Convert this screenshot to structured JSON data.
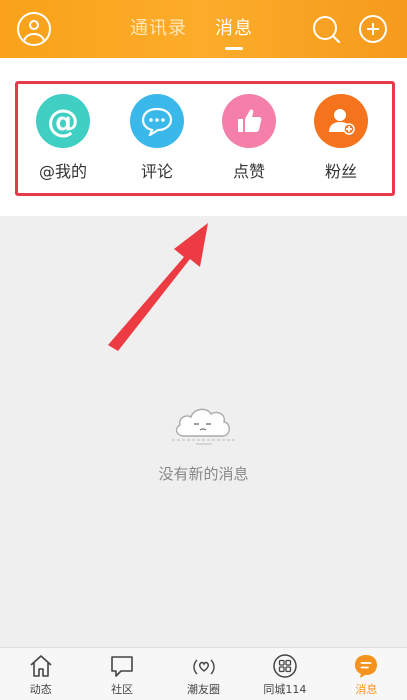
{
  "header": {
    "tabs": [
      {
        "label": "通讯录",
        "active": false
      },
      {
        "label": "消息",
        "active": true
      }
    ]
  },
  "categories": [
    {
      "label": "@我的",
      "icon": "at-icon",
      "color": "#3fd0c3"
    },
    {
      "label": "评论",
      "icon": "comment-icon",
      "color": "#3ab8ea"
    },
    {
      "label": "点赞",
      "icon": "thumbs-up-icon",
      "color": "#f47fa9"
    },
    {
      "label": "粉丝",
      "icon": "add-follower-icon",
      "color": "#f6731e"
    }
  ],
  "empty_state": {
    "text": "没有新的消息",
    "icon": "sleepy-cloud-icon"
  },
  "bottom_nav": [
    {
      "label": "动态",
      "icon": "home-icon",
      "active": false
    },
    {
      "label": "社区",
      "icon": "chat-bubble-icon",
      "active": false
    },
    {
      "label": "潮友圈",
      "icon": "heart-signal-icon",
      "active": false
    },
    {
      "label": "同城114",
      "icon": "grid-icon",
      "active": false
    },
    {
      "label": "消息",
      "icon": "message-icon",
      "active": true
    }
  ],
  "colors": {
    "header": "#fcac2a",
    "highlight": "#e8394a",
    "active": "#f6931e"
  }
}
